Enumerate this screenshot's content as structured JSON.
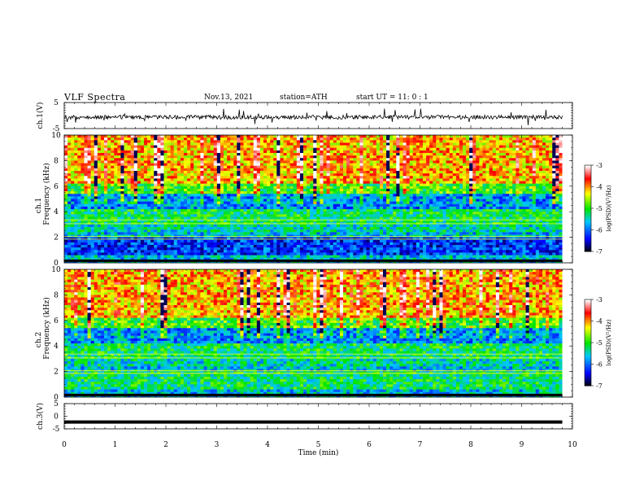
{
  "header": {
    "title": "VLF  Spectra",
    "date": "Nov.13, 2021",
    "station": "station=ATH",
    "start": "start  UT  =   11: 0  : 1"
  },
  "chart_data": {
    "type": "heatmap",
    "xlabel": "Time  (min)",
    "xlim": [
      0,
      10
    ],
    "x_ticks": [
      "0",
      "1",
      "2",
      "3",
      "4",
      "5",
      "6",
      "7",
      "8",
      "9",
      "10"
    ],
    "data_end_min": 9.8,
    "panels": [
      {
        "id": "ch1-waveform",
        "type": "line",
        "ylabel": "ch.1(V)",
        "ylim": [
          -5,
          5
        ],
        "y_ticks": [
          "5",
          "-5"
        ],
        "description_signal": "noisy waveform near 0 V with spikes reaching about ±3 V"
      },
      {
        "id": "ch1-spectrogram",
        "type": "heatmap",
        "ylabel_top": "ch.1",
        "ylabel": "Frequency  (kHz)",
        "ylim": [
          0,
          10
        ],
        "y_ticks": [
          "0",
          "2",
          "4",
          "6",
          "8",
          "10"
        ],
        "colorbar": {
          "label": "log(PSD)(V²/Hz)",
          "range": [
            -7,
            -3
          ],
          "ticks": [
            "-3",
            "-4",
            "-5",
            "-6",
            "-7"
          ],
          "colors": [
            "#000000",
            "#0000ff",
            "#00c8ff",
            "#00ff00",
            "#ffff00",
            "#ff0000",
            "#ffffff"
          ]
        }
      },
      {
        "id": "ch2-spectrogram",
        "type": "heatmap",
        "ylabel_top": "ch.2",
        "ylabel": "Frequency  (kHz)",
        "ylim": [
          0,
          10
        ],
        "y_ticks": [
          "0",
          "2",
          "4",
          "6",
          "8",
          "10"
        ],
        "colorbar": {
          "label": "log(PSD)(V²/Hz)",
          "range": [
            -7,
            -3
          ],
          "ticks": [
            "-3",
            "-4",
            "-5",
            "-6",
            "-7"
          ],
          "colors": [
            "#000000",
            "#0000ff",
            "#00c8ff",
            "#00ff00",
            "#ffff00",
            "#ff0000",
            "#ffffff"
          ]
        }
      },
      {
        "id": "ch3-waveform",
        "type": "line",
        "ylabel": "ch.3(V)",
        "ylim": [
          -5,
          5
        ],
        "y_ticks": [
          "5",
          "0",
          "-5"
        ],
        "level": -2.3,
        "description_signal": "flat thick trace near -2.3 V"
      }
    ]
  }
}
